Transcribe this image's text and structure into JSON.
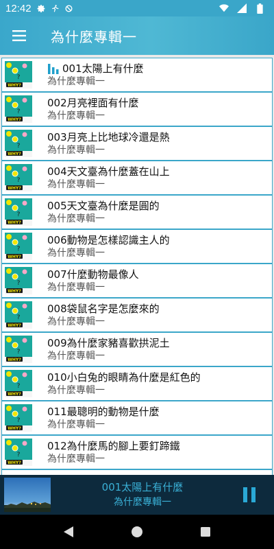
{
  "status_bar": {
    "time": "12:42",
    "icons": [
      "gear-icon",
      "runner-icon",
      "no-sync-icon",
      "wifi-icon",
      "signal-icon",
      "battery-icon"
    ]
  },
  "app_bar": {
    "title": "為什麼專輯一",
    "menu_icon": "hamburger-menu-icon"
  },
  "colors": {
    "accent": "#3aa6c9",
    "player_bg": "#0d2a3d",
    "player_text": "#3ab0d6"
  },
  "tracks": [
    {
      "title": "001太陽上有什麼",
      "album": "為什麼專輯一",
      "playing": true
    },
    {
      "title": "002月亮裡面有什麼",
      "album": "為什麼專輯一"
    },
    {
      "title": "003月亮上比地球冷還是熱",
      "album": "為什麼專輯一"
    },
    {
      "title": "004天文臺為什麼蓋在山上",
      "album": "為什麼專輯一"
    },
    {
      "title": "005天文臺為什麼是圓的",
      "album": "為什麼專輯一"
    },
    {
      "title": "006動物是怎樣認識主人的",
      "album": "為什麼專輯一"
    },
    {
      "title": "007什麼動物最像人",
      "album": "為什麼專輯一"
    },
    {
      "title": "008袋鼠名字是怎麼來的",
      "album": "為什麼專輯一"
    },
    {
      "title": "009為什麼家豬喜歡拱泥土",
      "album": "為什麼專輯一"
    },
    {
      "title": "010小白兔的眼睛為什麼是紅色的",
      "album": "為什麼專輯一"
    },
    {
      "title": "011最聰明的動物是什麼",
      "album": "為什麼專輯一"
    },
    {
      "title": "012為什麼馬的腳上要釘蹄鐵",
      "album": "為什麼專輯一"
    }
  ],
  "player": {
    "title": "001太陽上有什麼",
    "album": "為什麼專輯一",
    "state_icon": "pause-icon"
  },
  "nav_bar": {
    "icons": [
      "back-icon",
      "home-icon",
      "recents-icon"
    ]
  }
}
